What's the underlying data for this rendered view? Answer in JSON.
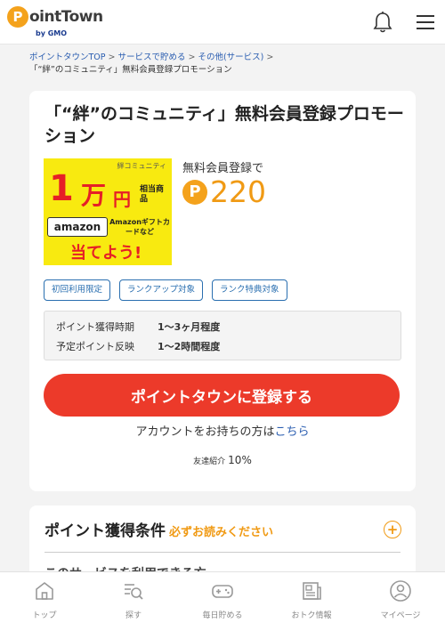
{
  "header": {
    "logo_initial": "P",
    "logo_text": "ointTown",
    "logo_sub": "by GMO",
    "bell_icon": "bell-icon",
    "menu_icon": "hamburger-menu-icon"
  },
  "breadcrumb": {
    "items": [
      "ポイントタウンTOP",
      "サービスで貯める",
      "その他(サービス)"
    ],
    "separator": ">",
    "current": "「“絆”のコミュニティ」無料会員登録プロモーション"
  },
  "promo": {
    "title": "「“絆”のコミュニティ」無料会員登録プロモーション",
    "banner": {
      "top_text": "絆コミュニティ",
      "amount": "1",
      "unit_man": "万",
      "unit_yen": "円",
      "equiv": "相当商品",
      "amazon": "amazon",
      "gift": "Amazonギフトカードなど",
      "cta": "当てよう!"
    },
    "reg_label": "無料会員登録で",
    "points_icon": "P",
    "points": "220",
    "tags": [
      "初回利用限定",
      "ランクアップ対象",
      "ランク特典対象"
    ],
    "info": [
      {
        "label": "ポイント獲得時期",
        "value": "1〜3ヶ月程度"
      },
      {
        "label": "予定ポイント反映",
        "value": "1〜2時間程度"
      }
    ],
    "register_button": "ポイントタウンに登録する",
    "account_text": "アカウントをお持ちの方は",
    "account_link": "こちら",
    "friend_label": "友達紹介",
    "friend_value": "10%"
  },
  "conditions": {
    "title": "ポイント獲得条件",
    "note": "必ずお読みください",
    "expand_icon": "plus-circle-icon",
    "subheading": "このサービスを利用できる方"
  },
  "bottom_nav": {
    "items": [
      {
        "label": "トップ",
        "icon": "home-icon"
      },
      {
        "label": "探す",
        "icon": "search-list-icon"
      },
      {
        "label": "毎日貯める",
        "icon": "gamepad-icon"
      },
      {
        "label": "おトク情報",
        "icon": "newspaper-icon"
      },
      {
        "label": "マイページ",
        "icon": "user-icon"
      }
    ]
  },
  "colors": {
    "brand_orange": "#f4a21c",
    "points_orange": "#f09a14",
    "cta_red": "#ec3a2a",
    "link_blue": "#2a5db0",
    "tag_blue": "#2a6fb0"
  }
}
